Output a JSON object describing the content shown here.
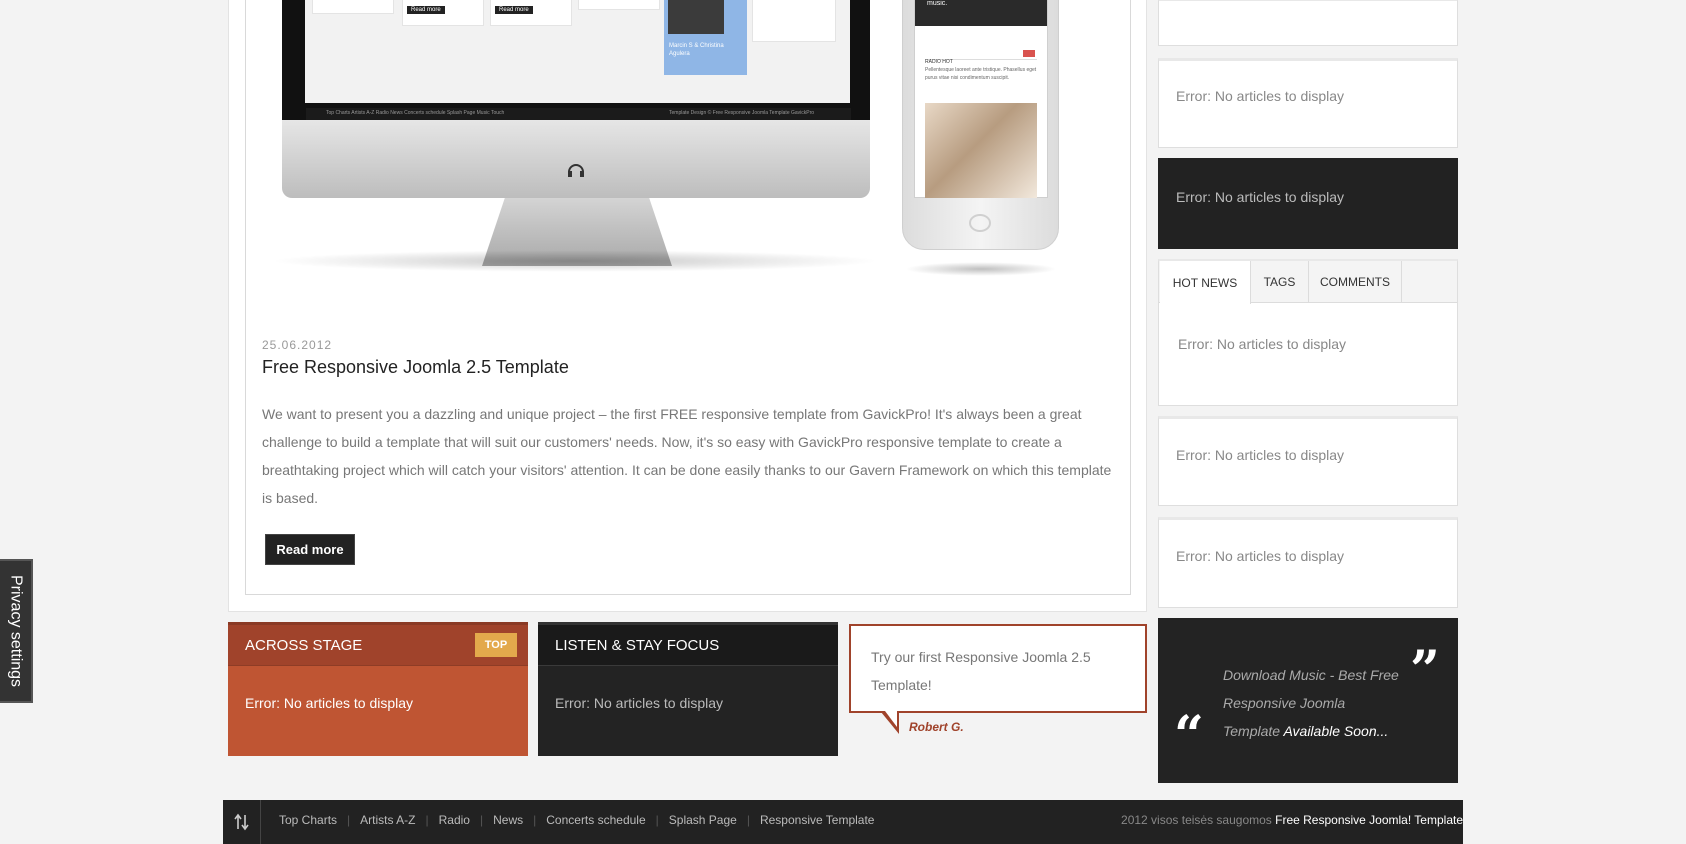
{
  "devices_image": {
    "imac_menu_text": "Top Charts  Artists A-Z  Radio  News  Concerts schedule  Splash Page  Music Touch",
    "imac_footer_text": "Template Design © Free Responsive Joomla Template GavickPro",
    "imac_btn1": "Read more",
    "imac_btn2": "Read more",
    "imac_bluecard_text": "Marcin S & Christina Agulera",
    "phone_header": "music.",
    "phone_section": "RADIO HOT",
    "phone_text": "Pellentesque laoreet ante tristique. Phasellus eget purus vitae nisi condimentum suscipit."
  },
  "post": {
    "date": "25.06.2012",
    "title": "Free Responsive Joomla 2.5 Template",
    "body": "We want to present you a dazzling and unique project – the first FREE responsive template from GavickPro! It's always been a great challenge to build a template that will suit our customers' needs. Now, it's so easy with GavickPro responsive template to create a breathtaking project which will catch your visitors' attention. It can be done easily thanks to our Gavern Framework on which this template is based.",
    "read_more": "Read more"
  },
  "box_across": {
    "title": "ACROSS STAGE",
    "badge": "TOP",
    "text": "Error: No articles to display"
  },
  "box_listen": {
    "title": "LISTEN & STAY FOCUS",
    "text": "Error: No articles to display"
  },
  "testimonial": {
    "text": "Try our first Responsive Joomla 2.5 Template!",
    "author": "Robert G."
  },
  "sidebar": {
    "box1_text": "Error: No articles to display",
    "box2_text": "Error: No articles to display",
    "tabs": [
      "HOT NEWS",
      "TAGS",
      "COMMENTS"
    ],
    "tab_content": "Error: No articles to display",
    "box4_text": "Error: No articles to display",
    "box5_text": "Error: No articles to display",
    "quote_text_1": "Download Music - Best Free Responsive Joomla Template ",
    "quote_text_2": "Available Soon..."
  },
  "footer": {
    "links": [
      "Top Charts",
      "Artists A-Z",
      "Radio",
      "News",
      "Concerts schedule",
      "Splash Page",
      "Responsive Template"
    ],
    "copyright": "2012 visos teisės saugomos ",
    "copyright_link": "Free Responsive Joomla! Template",
    "icon": "up-down-arrows-icon"
  },
  "privacy": {
    "label": "Privacy settings"
  },
  "colors": {
    "accent": "#bf5533",
    "accent_dark": "#a0432b",
    "badge": "#e3a94c",
    "dark": "#232323"
  }
}
